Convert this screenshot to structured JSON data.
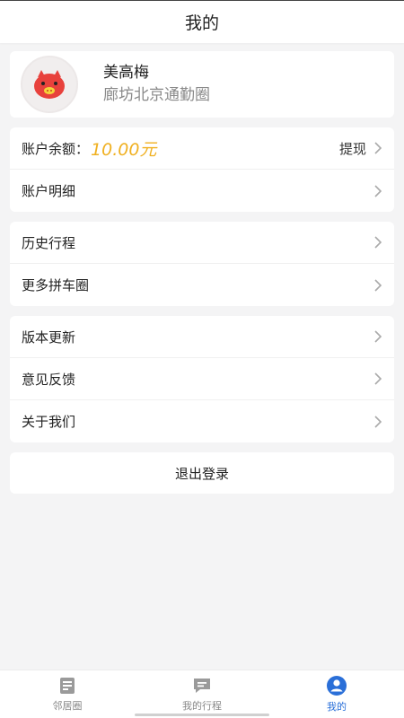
{
  "header": {
    "title": "我的"
  },
  "profile": {
    "name": "美高梅",
    "circle": "廊坊北京通勤圈",
    "avatar_icon": "pig-avatar-icon"
  },
  "account": {
    "balance_label": "账户余额：",
    "balance_value": "10.00元",
    "withdraw_label": "提现",
    "detail_label": "账户明细"
  },
  "trips": {
    "history_label": "历史行程",
    "more_circles_label": "更多拼车圈"
  },
  "about": {
    "update_label": "版本更新",
    "feedback_label": "意见反馈",
    "about_label": "关于我们"
  },
  "logout_label": "退出登录",
  "tabbar": {
    "tabs": [
      {
        "label": "邻居圈",
        "icon": "news-icon",
        "active": false
      },
      {
        "label": "我的行程",
        "icon": "chat-icon",
        "active": false
      },
      {
        "label": "我的",
        "icon": "user-icon",
        "active": true
      }
    ]
  },
  "colors": {
    "accent": "#2a6fd8",
    "balance": "#f0b020"
  }
}
